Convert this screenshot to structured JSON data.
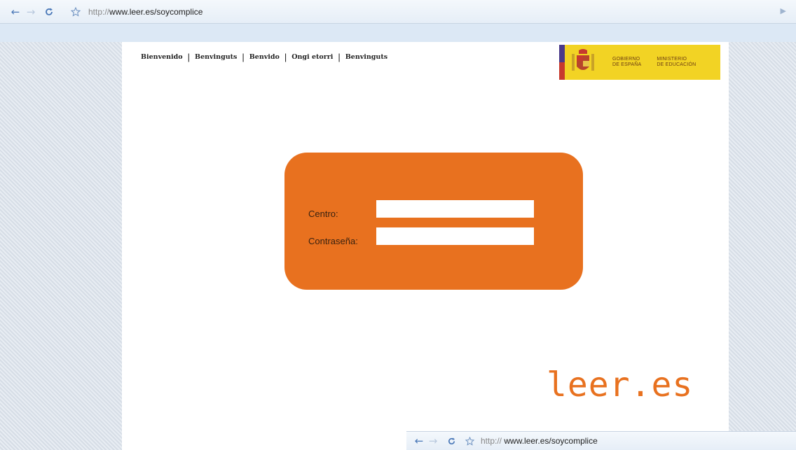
{
  "browser": {
    "url_protocol": "http://",
    "url_host": "www.leer.es/soycomplice"
  },
  "icons": {
    "back": "back-arrow-icon",
    "forward": "forward-arrow-icon",
    "reload": "reload-icon",
    "bookmark": "star-icon",
    "go": "go-arrow-icon"
  },
  "languages": [
    "Bienvenido",
    "Benvinguts",
    "Benvido",
    "Ongi etorri",
    "Benvinguts"
  ],
  "gov_logo": {
    "line1a": "GOBIERNO",
    "line1b": "DE ESPAÑA",
    "line2a": "MINISTERIO",
    "line2b": "DE EDUCACIÓN"
  },
  "login": {
    "centro_label": "Centro:",
    "centro_value": "",
    "password_label": "Contraseña:",
    "password_value": ""
  },
  "brand": "leer.es",
  "colors": {
    "accent": "#e8711f",
    "gov_yellow": "#f2d324"
  }
}
